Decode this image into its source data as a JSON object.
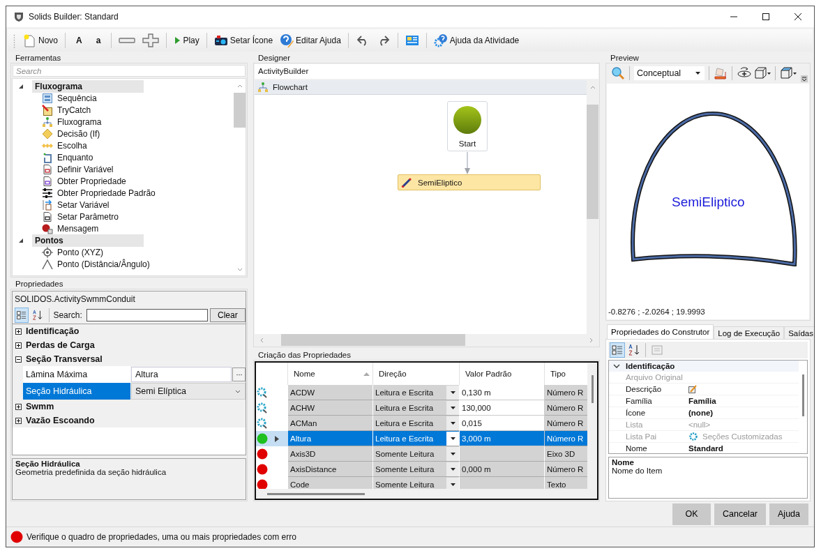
{
  "window": {
    "title": "Solids Builder: Standard"
  },
  "toolbar": [
    [
      {
        "kind": "new",
        "label": "Novo"
      }
    ],
    [
      {
        "kind": "font-up",
        "label": "A"
      },
      {
        "kind": "font-down",
        "label": "a"
      }
    ],
    [
      {
        "kind": "minus"
      },
      {
        "kind": "plus"
      }
    ],
    [
      {
        "kind": "play",
        "label": "Play"
      }
    ],
    [
      {
        "kind": "icon",
        "label": "Setar Ícone"
      },
      {
        "kind": "help-edit",
        "label": "Editar Ajuda"
      }
    ],
    [
      {
        "kind": "undo"
      },
      {
        "kind": "redo"
      }
    ],
    [
      {
        "kind": "panel"
      }
    ],
    [
      {
        "kind": "activity-help",
        "label": "Ajuda da Atividade"
      }
    ]
  ],
  "tools": {
    "title": "Ferramentas",
    "search_placeholder": "Search",
    "categories": [
      {
        "label": "Fluxograma",
        "expanded": true,
        "children": [
          {
            "label": "Sequência",
            "kind": "sequence"
          },
          {
            "label": "TryCatch",
            "kind": "trycatch"
          },
          {
            "label": "Fluxograma",
            "kind": "flow"
          },
          {
            "label": "Decisão (If)",
            "kind": "decision"
          },
          {
            "label": "Escolha",
            "kind": "choice"
          },
          {
            "label": "Enquanto",
            "kind": "loop"
          },
          {
            "label": "Definir Variável",
            "kind": "variable"
          },
          {
            "label": "Obter Propriedade",
            "kind": "property"
          },
          {
            "label": "Obter Propriedade Padrão",
            "kind": "sliders"
          },
          {
            "label": "Setar Variável",
            "kind": "set-variable"
          },
          {
            "label": "Setar Parâmetro",
            "kind": "parameter"
          },
          {
            "label": "Mensagem",
            "kind": "message"
          }
        ]
      },
      {
        "label": "Pontos",
        "expanded": true,
        "children": [
          {
            "label": "Ponto (XYZ)",
            "kind": "point"
          },
          {
            "label": "Ponto (Distância/Ângulo)",
            "kind": "angle"
          }
        ]
      }
    ]
  },
  "properties": {
    "title": "Propriedades",
    "object": "SOLIDOS.ActivitySwmmConduit",
    "search_label": "Search:",
    "clear": "Clear",
    "groups": [
      {
        "label": "Identificação",
        "expanded": false
      },
      {
        "label": "Perdas de Carga",
        "expanded": false
      },
      {
        "label": "Seção Transversal",
        "expanded": true,
        "rows": [
          {
            "name": "Lâmina Máxima",
            "value": "Altura",
            "kind": "ellipsis",
            "selected": false
          },
          {
            "name": "Seção Hidráulica",
            "value": "Semi Elíptica",
            "kind": "dropdown",
            "selected": true
          }
        ]
      },
      {
        "label": "Swmm",
        "expanded": false
      },
      {
        "label": "Vazão Escoando",
        "expanded": false
      }
    ],
    "help": {
      "title": "Seção Hidráulica",
      "text": "Geometria predefinida da seção hidráulica"
    }
  },
  "designer": {
    "title": "Designer",
    "breadcrumb": "ActivityBuilder",
    "flowchart": "Flowchart",
    "start": "Start",
    "activity": "SemiEliptico"
  },
  "grid": {
    "title": "Criação das Propriedades",
    "columns": [
      {
        "label": "Nome",
        "sorted": true
      },
      {
        "label": "Direção",
        "sorted": false
      },
      {
        "label": "Valor Padrão",
        "sorted": false
      },
      {
        "label": "Tipo",
        "sorted": false
      }
    ],
    "rows": [
      {
        "kind": "gear",
        "name": "ACDW",
        "direction": "Leitura e Escrita",
        "value": "0,130 m",
        "type": "Número R",
        "editable": true,
        "selected": false
      },
      {
        "kind": "gear",
        "name": "ACHW",
        "direction": "Leitura e Escrita",
        "value": "130,000",
        "type": "Número R",
        "editable": true,
        "selected": false
      },
      {
        "kind": "gear",
        "name": "ACMan",
        "direction": "Leitura e Escrita",
        "value": "0,015",
        "type": "Número R",
        "editable": true,
        "selected": false
      },
      {
        "kind": "ok",
        "name": "Altura",
        "direction": "Leitura e Escrita",
        "value": "3,000 m",
        "type": "Número R",
        "editable": true,
        "selected": true
      },
      {
        "kind": "error",
        "name": "Axis3D",
        "direction": "Somente Leitura",
        "type": "Eixo 3D",
        "editable": false,
        "selected": false
      },
      {
        "kind": "error",
        "name": "AxisDistance",
        "direction": "Somente Leitura",
        "value": "0,000 m",
        "type": "Número R",
        "editable": false,
        "selected": false
      },
      {
        "kind": "error",
        "name": "Code",
        "direction": "Somente Leitura",
        "type": "Texto",
        "editable": false,
        "selected": false
      }
    ]
  },
  "preview": {
    "title": "Preview",
    "view_mode": "Conceptual",
    "label": "SemiEliptico",
    "coordinates": "-0.8276 ; -2.0264 ; 19.9993"
  },
  "builder": {
    "tabs": [
      {
        "label": "Propriedades do Construtor",
        "selected": true
      },
      {
        "label": "Log de Execução",
        "selected": false
      },
      {
        "label": "Saídas",
        "selected": false
      }
    ],
    "category": {
      "label": "Identificação",
      "expanded": true
    },
    "rows": [
      {
        "name": "Arquivo Original",
        "kind": "plain",
        "disabled": true
      },
      {
        "name": "Descrição",
        "kind": "edit",
        "disabled": false
      },
      {
        "name": "Família",
        "value": "Família",
        "kind": "bold",
        "disabled": false
      },
      {
        "name": "Ícone",
        "value": "(none)",
        "kind": "bold",
        "disabled": false
      },
      {
        "name": "Lista",
        "value": "<null>",
        "kind": "plain",
        "disabled": true
      },
      {
        "name": "Lista Pai",
        "value": "Seções Customizadas",
        "kind": "list",
        "disabled": true
      },
      {
        "name": "Nome",
        "value": "Standard",
        "kind": "bold",
        "disabled": false
      }
    ],
    "help": {
      "title": "Nome",
      "text": "Nome do Item"
    }
  },
  "buttons": [
    "OK",
    "Cancelar",
    "Ajuda"
  ],
  "status": {
    "kind": "error",
    "text": "Verifique o quadro de propriedades, uma ou mais propriedades com erro"
  }
}
